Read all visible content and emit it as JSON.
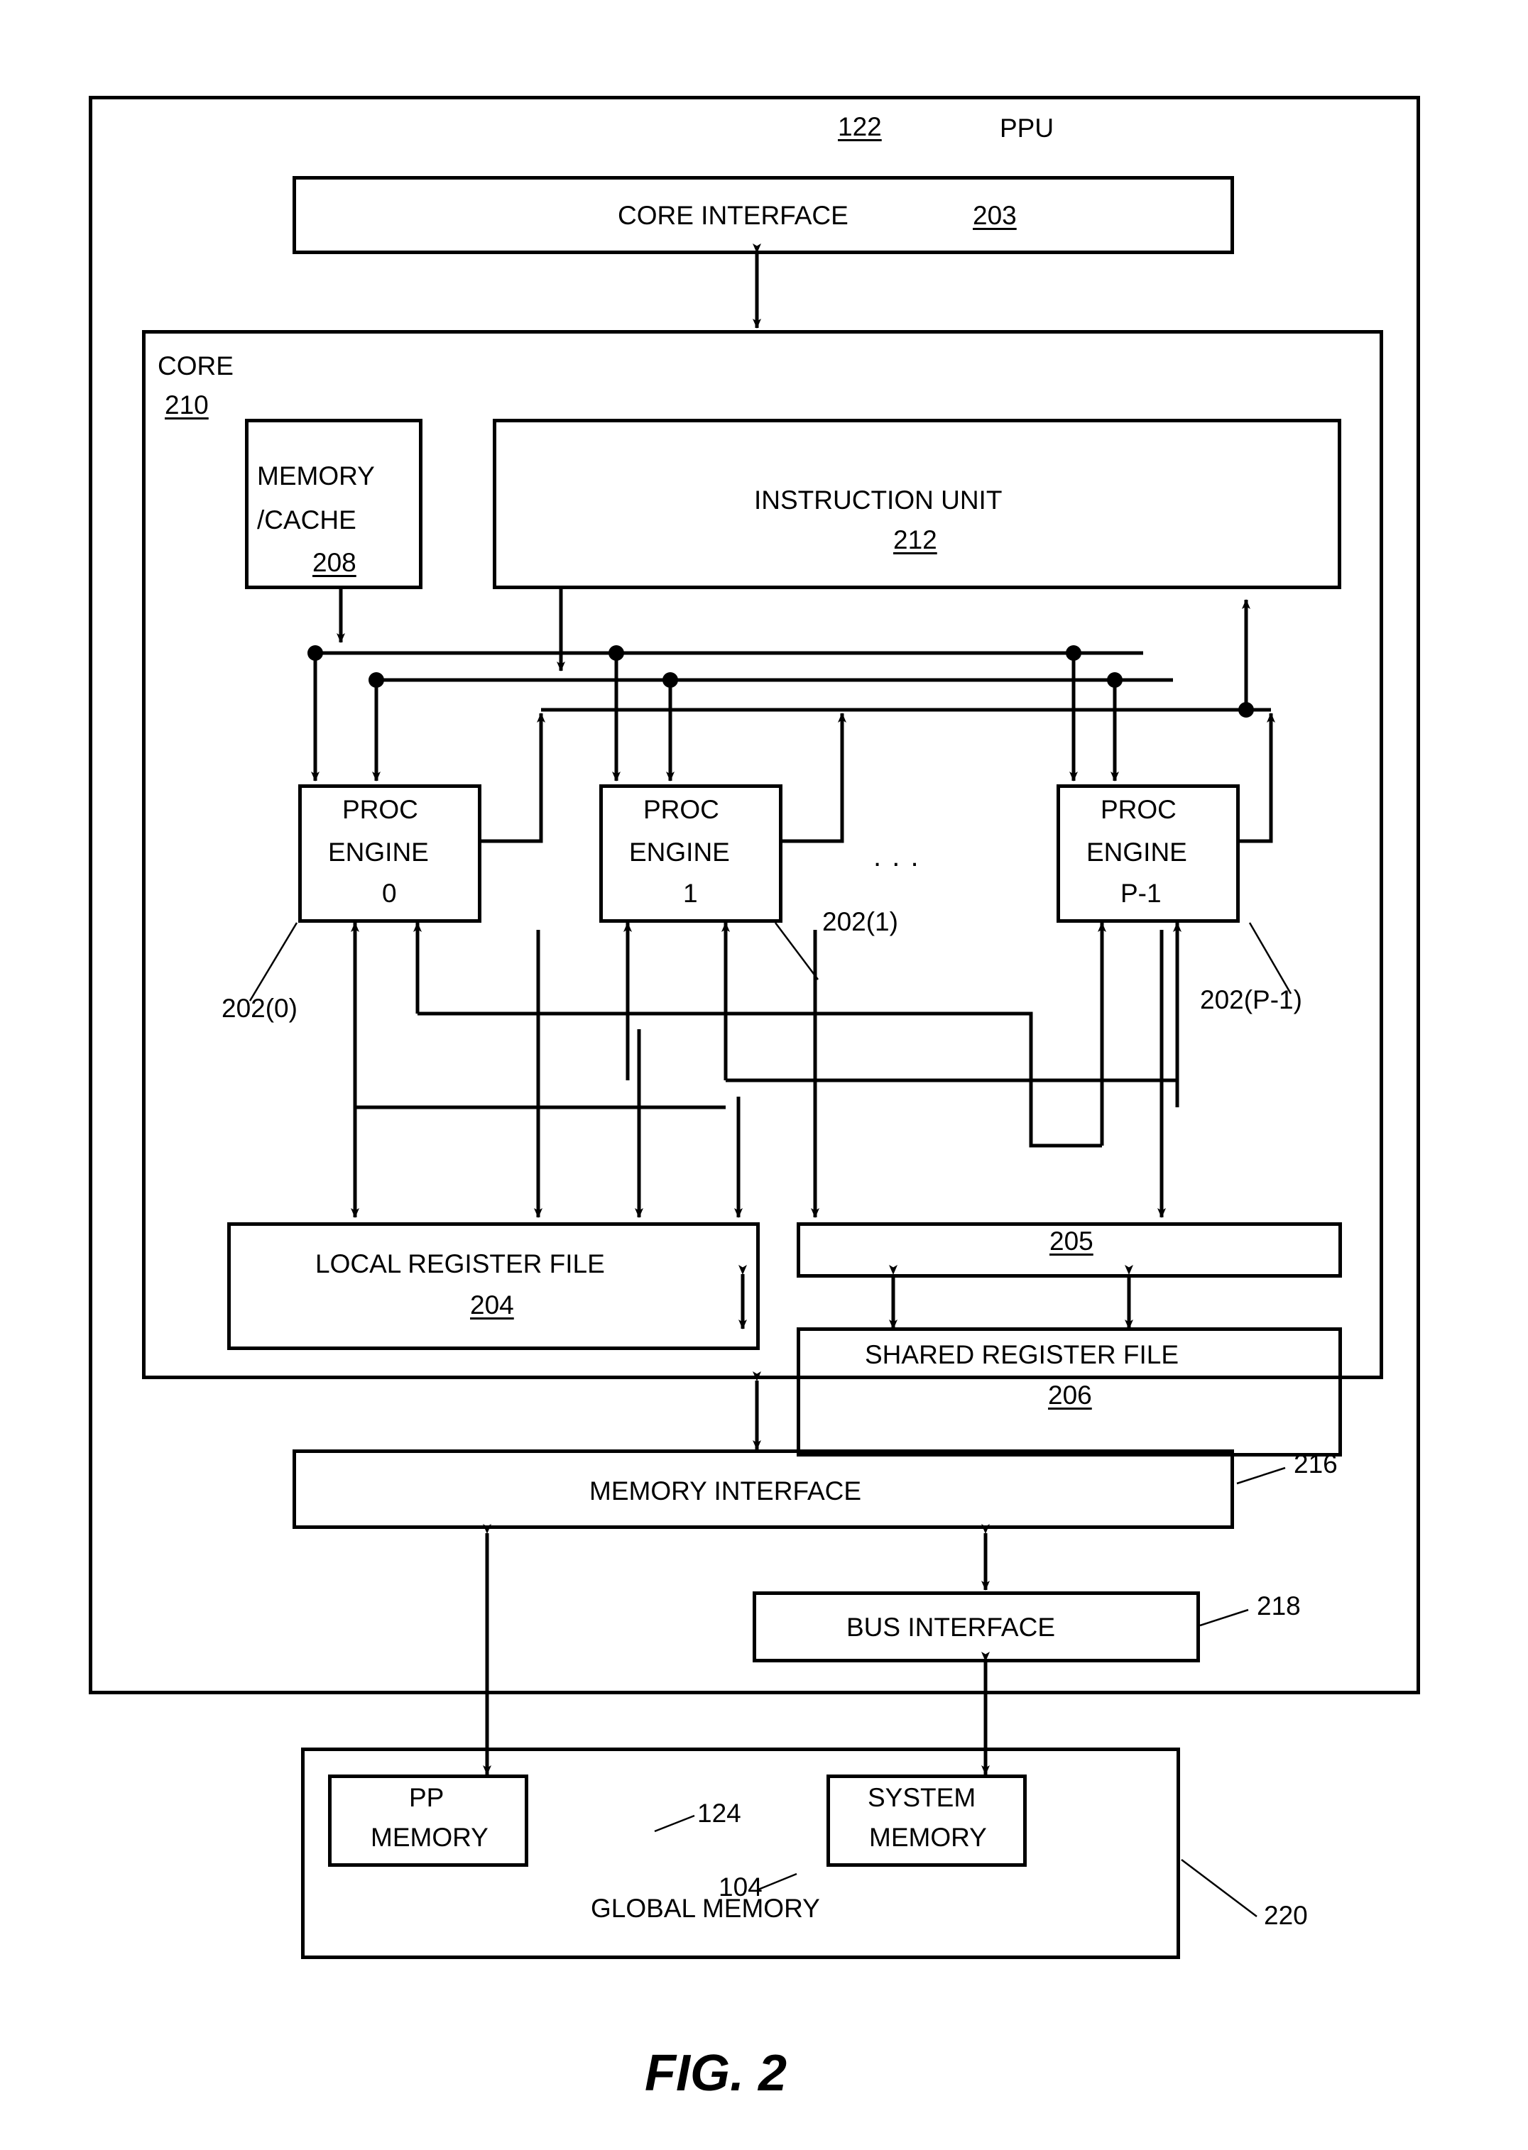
{
  "figure": {
    "caption": "FIG. 2",
    "type": "patent-block-diagram"
  },
  "ppu": {
    "label": "PPU",
    "ref": "122"
  },
  "core_interface": {
    "label": "CORE INTERFACE",
    "ref": "203"
  },
  "core": {
    "label": "CORE",
    "ref": "210"
  },
  "memory_cache": {
    "line1": "MEMORY",
    "line2": "/CACHE",
    "ref": "208"
  },
  "instruction_unit": {
    "label": "INSTRUCTION UNIT",
    "ref": "212"
  },
  "proc_engines": [
    {
      "line1": "PROC",
      "line2": "ENGINE",
      "index": "0",
      "ref": "202(0)"
    },
    {
      "line1": "PROC",
      "line2": "ENGINE",
      "index": "1",
      "ref": "202(1)"
    },
    {
      "line1": "PROC",
      "line2": "ENGINE",
      "index": "P-1",
      "ref": "202(P-1)"
    }
  ],
  "ellipsis": ". . .",
  "local_register_file": {
    "label": "LOCAL REGISTER FILE",
    "ref": "204"
  },
  "crossbar": {
    "ref": "205"
  },
  "shared_register_file": {
    "label": "SHARED REGISTER FILE",
    "ref": "206"
  },
  "memory_interface": {
    "label": "MEMORY INTERFACE",
    "ref": "216"
  },
  "bus_interface": {
    "label": "BUS INTERFACE",
    "ref": "218"
  },
  "global_memory": {
    "label": "GLOBAL MEMORY",
    "ref": "220"
  },
  "pp_memory": {
    "line1": "PP",
    "line2": "MEMORY",
    "ref": "124"
  },
  "system_memory": {
    "line1": "SYSTEM",
    "line2": "MEMORY",
    "ref": "104"
  },
  "colors": {
    "line": "#000000",
    "background": "#ffffff"
  }
}
